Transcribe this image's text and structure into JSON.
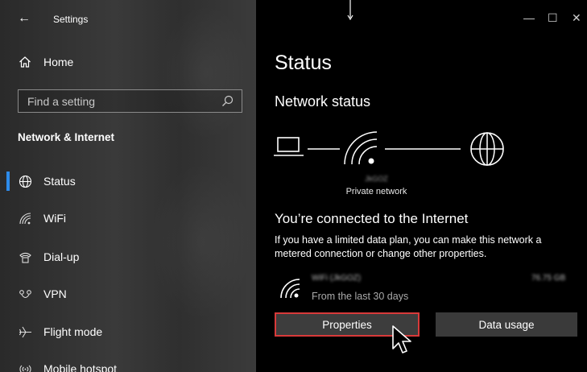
{
  "window": {
    "title": "Settings",
    "controls": {
      "minimize": "—",
      "maximize": "☐",
      "close": "✕"
    }
  },
  "sidebar": {
    "home_label": "Home",
    "search_placeholder": "Find a setting",
    "section_title": "Network & Internet",
    "items": [
      {
        "label": "Status",
        "icon": "globe-icon",
        "selected": true
      },
      {
        "label": "WiFi",
        "icon": "wifi-icon"
      },
      {
        "label": "Dial-up",
        "icon": "phone-icon"
      },
      {
        "label": "VPN",
        "icon": "vpn-icon"
      },
      {
        "label": "Flight mode",
        "icon": "airplane-icon"
      },
      {
        "label": "Mobile hotspot",
        "icon": "hotspot-icon"
      }
    ],
    "accent_color": "#2d8bea"
  },
  "main": {
    "page_title": "Status",
    "section_title": "Network status",
    "network": {
      "name": "JkGOZ",
      "type": "Private network"
    },
    "connected_title": "You’re connected to the Internet",
    "connected_desc": "If you have a limited data plan, you can make this network a metered connection or change other properties.",
    "usage": {
      "name": "WiFi (JkGOZ)",
      "amount": "76.75 GB",
      "period": "From the last 30 days"
    },
    "buttons": {
      "properties": "Properties",
      "data_usage": "Data usage"
    },
    "highlight_color": "#d83a3a"
  }
}
